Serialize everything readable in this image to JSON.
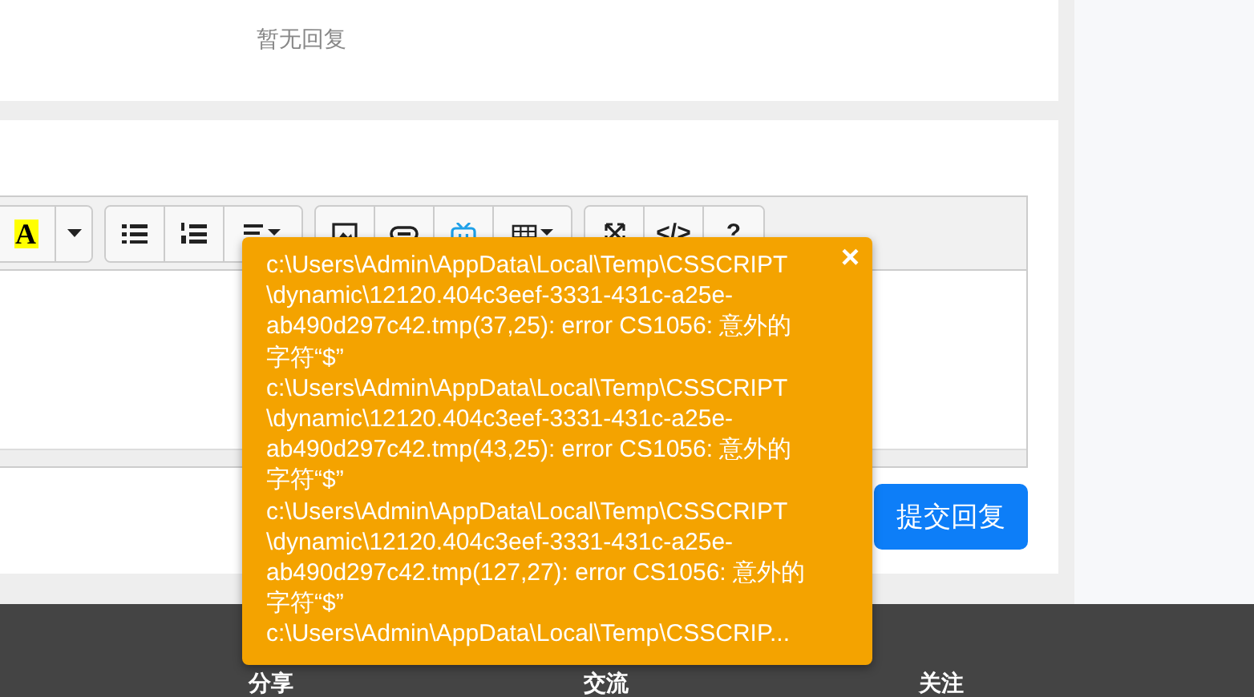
{
  "replies": {
    "empty_text": "暂无回复"
  },
  "toolbar": {
    "groups": [
      {
        "buttons": [
          {
            "kind": "color",
            "label": "A"
          },
          {
            "kind": "caret"
          }
        ]
      },
      {
        "buttons": [
          {
            "kind": "ul"
          },
          {
            "kind": "ol"
          },
          {
            "kind": "align"
          }
        ]
      },
      {
        "buttons": [
          {
            "kind": "image"
          },
          {
            "kind": "link"
          },
          {
            "kind": "video"
          },
          {
            "kind": "table"
          }
        ]
      },
      {
        "buttons": [
          {
            "kind": "fullscreen"
          },
          {
            "kind": "text",
            "label": "</>"
          },
          {
            "kind": "text",
            "label": "?"
          }
        ]
      }
    ]
  },
  "submit_button": "提交回复",
  "error_popup": {
    "close": "×",
    "lines": [
      "c:\\Users\\Admin\\AppData\\Local\\Temp\\CSSCRIPT",
      "\\dynamic\\12120.404c3eef-3331-431c-a25e-",
      "ab490d297c42.tmp(37,25): error CS1056: 意外的",
      "字符“$”",
      "c:\\Users\\Admin\\AppData\\Local\\Temp\\CSSCRIPT",
      "\\dynamic\\12120.404c3eef-3331-431c-a25e-",
      "ab490d297c42.tmp(43,25): error CS1056: 意外的",
      "字符“$”",
      "c:\\Users\\Admin\\AppData\\Local\\Temp\\CSSCRIPT",
      "\\dynamic\\12120.404c3eef-3331-431c-a25e-",
      "ab490d297c42.tmp(127,27): error CS1056: 意外的",
      "字符“$”",
      "c:\\Users\\Admin\\AppData\\Local\\Temp\\CSSCRIP..."
    ]
  },
  "footer": {
    "headings": [
      "分享",
      "交流",
      "关注"
    ]
  }
}
